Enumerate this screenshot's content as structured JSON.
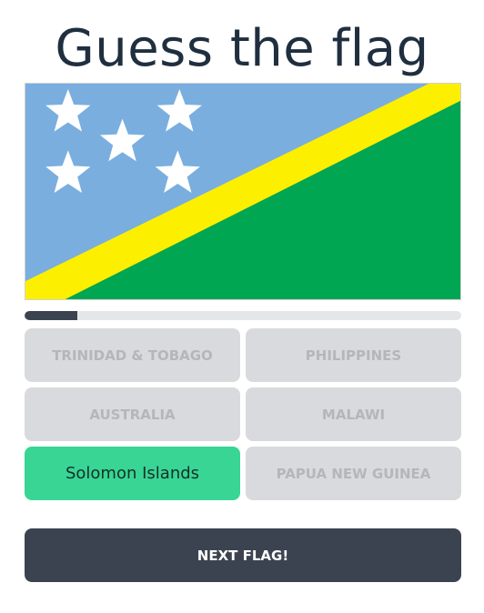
{
  "title": "Guess the flag",
  "flag": {
    "country": "Solomon Islands",
    "colors": {
      "blue": "#7aaedf",
      "green": "#00a651",
      "yellow": "#fcef00",
      "stars": "#ffffff"
    }
  },
  "progress": {
    "fraction": 0.12
  },
  "answers": [
    {
      "label": "TRINIDAD & TOBAGO",
      "state": "disabled"
    },
    {
      "label": "PHILIPPINES",
      "state": "disabled"
    },
    {
      "label": "AUSTRALIA",
      "state": "disabled"
    },
    {
      "label": "MALAWI",
      "state": "disabled"
    },
    {
      "label": "Solomon Islands",
      "state": "correct"
    },
    {
      "label": "PAPUA NEW GUINEA",
      "state": "disabled"
    }
  ],
  "next_button": {
    "label": "NEXT FLAG!"
  },
  "colors": {
    "correct": "#38d595",
    "disabled_bg": "#d9dadd",
    "disabled_text": "#b4b6bb",
    "dark": "#3c4350"
  }
}
